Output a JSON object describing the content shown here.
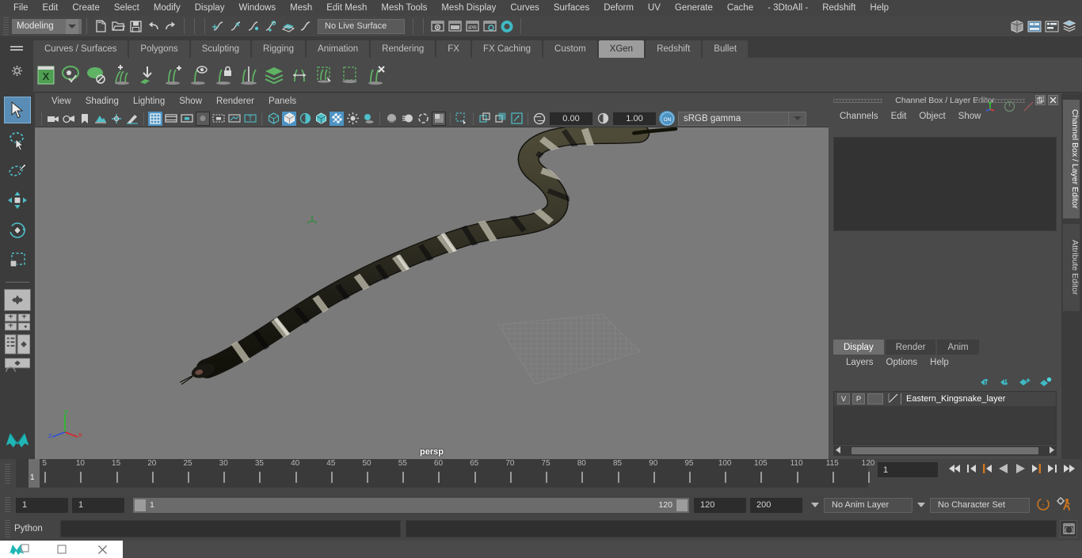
{
  "app": {
    "menus": [
      "File",
      "Edit",
      "Create",
      "Select",
      "Modify",
      "Display",
      "Windows",
      "Mesh",
      "Edit Mesh",
      "Mesh Tools",
      "Mesh Display",
      "Curves",
      "Surfaces",
      "Deform",
      "UV",
      "Generate",
      "Cache",
      "- 3DtoAll -",
      "Redshift",
      "Help"
    ],
    "menuset": "Modeling",
    "live_surface": "No Live Surface"
  },
  "shelf": {
    "tabs": [
      "Curves / Surfaces",
      "Polygons",
      "Sculpting",
      "Rigging",
      "Animation",
      "Rendering",
      "FX",
      "FX Caching",
      "Custom",
      "XGen",
      "Redshift",
      "Bullet"
    ],
    "active_tab": "XGen",
    "icons": [
      "xgen-editor-icon",
      "xgen-preview-icon",
      "xgen-disable-preview-icon",
      "xgen-add-description-icon",
      "xgen-import-icon",
      "xgen-add-guide-icon",
      "xgen-view-guide-icon",
      "xgen-lock-guide-icon",
      "xgen-mirror-guide-icon",
      "xgen-layers-icon",
      "xgen-convert-icon",
      "xgen-select-region-icon",
      "xgen-region-icon",
      "xgen-delete-guide-icon"
    ]
  },
  "tools": [
    {
      "name": "select-tool",
      "label": "Select Tool",
      "selected": true
    },
    {
      "name": "lasso-select-tool",
      "label": "Lasso Select Tool",
      "selected": false
    },
    {
      "name": "paint-select-tool",
      "label": "Paint Select Tool",
      "selected": false
    },
    {
      "name": "move-tool",
      "label": "Move Tool",
      "selected": false
    },
    {
      "name": "rotate-tool",
      "label": "Rotate Tool",
      "selected": false
    },
    {
      "name": "scale-tool",
      "label": "Scale Tool",
      "selected": false
    }
  ],
  "viewport": {
    "menus": [
      "View",
      "Shading",
      "Lighting",
      "Show",
      "Renderer",
      "Panels"
    ],
    "camera_label": "persp",
    "exposure": "0.00",
    "gamma": "1.00",
    "color_management": "sRGB gamma",
    "toggle_on_label": "ON",
    "axis": {
      "x": "x",
      "y": "y",
      "z": "z",
      "x_color": "#e02020",
      "y_color": "#22c322",
      "z_color": "#2d4fe0"
    },
    "background_color": "#7a7a7a",
    "model": {
      "name": "Eastern Kingsnake",
      "body_dark": "#1b1a15",
      "body_mid": "#3c3a2c",
      "band_light": "#cfcdc0"
    }
  },
  "channel_box": {
    "title": "Channel Box / Layer Editor",
    "menus": [
      "Channels",
      "Edit",
      "Object",
      "Show"
    ],
    "vertical_tabs": [
      "Channel Box / Layer Editor",
      "Attribute Editor"
    ],
    "active_vertical_tab": "Channel Box / Layer Editor"
  },
  "layer_editor": {
    "tabs": [
      "Display",
      "Render",
      "Anim"
    ],
    "active_tab": "Display",
    "menus": [
      "Layers",
      "Options",
      "Help"
    ],
    "buttons": [
      "move-layer-up-icon",
      "move-layer-down-icon",
      "new-layer-icon",
      "new-layer-from-selected-icon"
    ],
    "layers": [
      {
        "visibility": "V",
        "playback": "P",
        "type": "",
        "name": "Eastern_Kingsnake_layer"
      }
    ]
  },
  "timeline": {
    "start": 1,
    "end": 120,
    "current_frame": "1",
    "tick_labels": [
      5,
      10,
      15,
      20,
      25,
      30,
      35,
      40,
      45,
      50,
      55,
      60,
      65,
      70,
      75,
      80,
      85,
      90,
      95,
      100,
      105,
      110,
      115,
      120
    ],
    "current_marker_label": "1",
    "playback_buttons": [
      "go-to-start-icon",
      "step-back-frame-icon",
      "step-back-key-icon",
      "play-backwards-icon",
      "play-forwards-icon",
      "step-forward-key-icon",
      "step-forward-frame-icon",
      "go-to-end-icon"
    ],
    "accent_color": "#d0761e"
  },
  "range": {
    "anim_start": "1",
    "range_start": "1",
    "slider_min_label": "1",
    "slider_max_label": "120",
    "range_end": "120",
    "anim_end": "200",
    "anim_layer": "No Anim Layer",
    "character_set": "No Character Set",
    "icons": [
      "auto-key-icon",
      "animation-preferences-icon"
    ]
  },
  "command_line": {
    "language": "Python",
    "input_value": "",
    "script_editor_icon": "script-editor-icon"
  },
  "taskbar": {
    "items": [
      "maya-app-icon",
      "restore-window-icon",
      "close-window-icon"
    ]
  },
  "top_right_icons": [
    "modeling-toolkit-icon",
    "attribute-editor-icon",
    "tool-settings-icon",
    "channel-box-icon"
  ]
}
